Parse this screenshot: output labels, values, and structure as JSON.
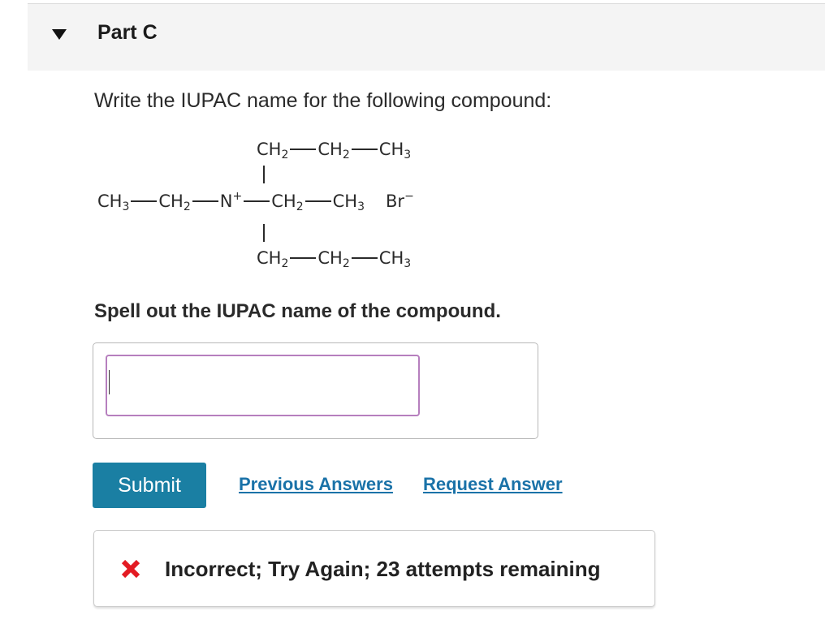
{
  "part": {
    "title": "Part C",
    "toggle_icon": "triangle-down-icon"
  },
  "question": {
    "text": "Write the IUPAC name for the following compound:"
  },
  "structure": {
    "top": [
      "CH",
      "2",
      "CH",
      "2",
      "CH",
      "3"
    ],
    "middle": {
      "left": [
        "CH",
        "3",
        "CH",
        "2"
      ],
      "center": "N",
      "charge": "+",
      "right": [
        "CH",
        "2",
        "CH",
        "3"
      ],
      "counter_ion": "Br",
      "counter_charge": "−"
    },
    "bottom": [
      "CH",
      "2",
      "CH",
      "2",
      "CH",
      "3"
    ]
  },
  "prompt": {
    "text": "Spell out the IUPAC name of the compound."
  },
  "answer": {
    "value": "",
    "placeholder": ""
  },
  "actions": {
    "submit_label": "Submit",
    "previous_answers_label": "Previous Answers",
    "request_answer_label": "Request Answer"
  },
  "feedback": {
    "icon": "x-icon",
    "text": "Incorrect; Try Again; 23 attempts remaining",
    "color": "#e31b23"
  },
  "colors": {
    "submit_bg": "#1a7fa3",
    "link": "#1a72a8",
    "input_border": "#b67fbe"
  }
}
